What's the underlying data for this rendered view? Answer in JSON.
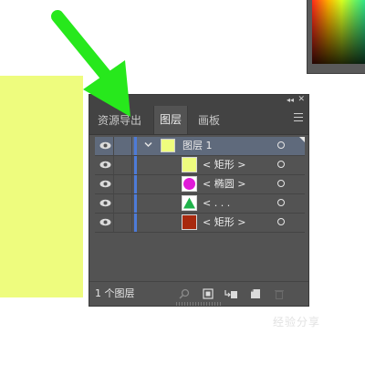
{
  "panel": {
    "tabs": [
      "资源导出",
      "图层",
      "画板"
    ],
    "collapse_glyph": "◂◂",
    "close_glyph": "✕",
    "layers": [
      {
        "name": "图层  1",
        "thumbnail_color": "#eefc7e",
        "selected": true,
        "expanded": true
      },
      {
        "name": "< 矩形 >",
        "shape": "rectangle",
        "thumbnail_color": "#eefc7e"
      },
      {
        "name": "< 椭圆 >",
        "shape": "ellipse",
        "thumbnail_color": "#e01ad8"
      },
      {
        "name": "< . . .",
        "shape": "triangle",
        "thumbnail_color": "#1fb24a"
      },
      {
        "name": "< 矩形 >",
        "shape": "rectangle",
        "thumbnail_color": "#a8290e"
      }
    ],
    "footer_label": "1 个图层",
    "footer_icons": [
      "search-icon",
      "make-clipping-mask-icon",
      "create-sublayer-icon",
      "create-new-layer-icon",
      "delete-icon"
    ]
  },
  "colors": {
    "accent": "#4d7bd8",
    "arrow": "#27e81c",
    "artboard_fill": "#eefc7e",
    "panel_bg": "#535353"
  },
  "watermark": "经验分享"
}
